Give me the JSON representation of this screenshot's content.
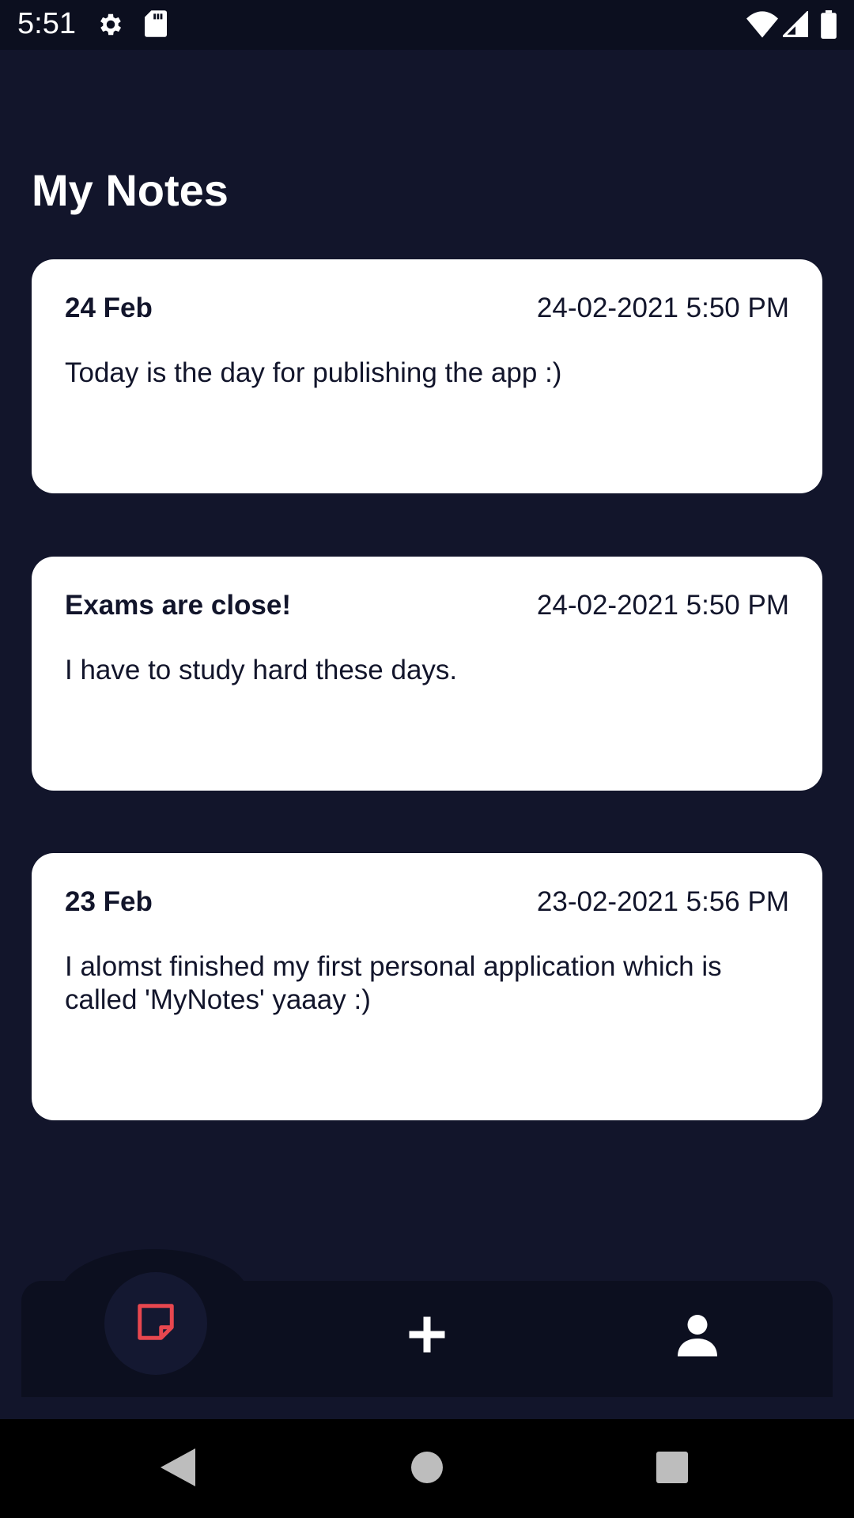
{
  "status_bar": {
    "time": "5:51",
    "icons": [
      "gear-icon",
      "sd-card-icon",
      "wifi-icon",
      "signal-icon",
      "battery-icon"
    ]
  },
  "header": {
    "title": "My Notes"
  },
  "notes": [
    {
      "title": "24 Feb",
      "datetime": "24-02-2021 5:50 PM",
      "body": "Today is the day for publishing the app :)"
    },
    {
      "title": "Exams are close!",
      "datetime": "24-02-2021 5:50 PM",
      "body": "I have to study hard these days."
    },
    {
      "title": "23 Feb",
      "datetime": "23-02-2021 5:56 PM",
      "body": "I alomst finished my first personal application which is called 'MyNotes' yaaay :)"
    }
  ],
  "bottom_nav": {
    "items": [
      {
        "icon": "note-icon",
        "active": true
      },
      {
        "icon": "plus-icon",
        "active": false
      },
      {
        "icon": "person-icon",
        "active": false
      }
    ],
    "active_color": "#e8474f"
  },
  "colors": {
    "background": "#12152b",
    "card": "#ffffff",
    "nav": "#0c0f1f",
    "text_dark": "#12152b"
  }
}
